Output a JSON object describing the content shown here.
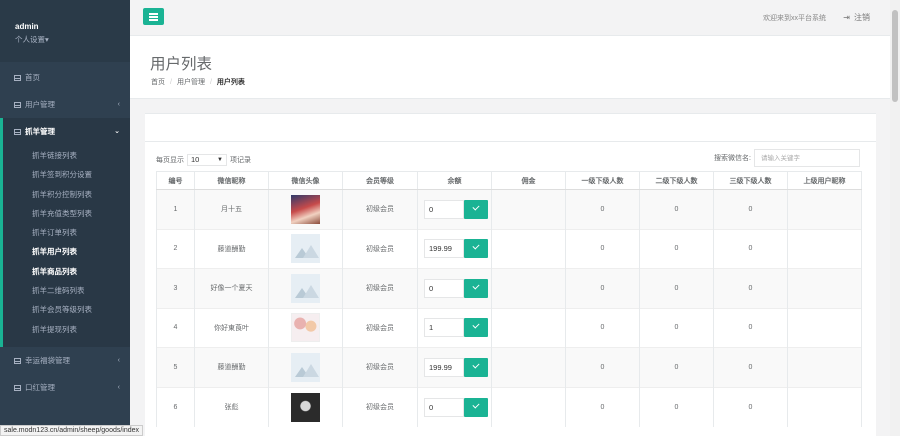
{
  "sidebar": {
    "username": "admin",
    "settings_label": "个人设置▾",
    "items": [
      {
        "label": "首页",
        "chevron": ""
      },
      {
        "label": "用户管理",
        "chevron": "‹"
      }
    ],
    "active_group": {
      "label": "抓羊管理",
      "chevron": "⌄"
    },
    "sub_items": [
      "抓羊链接列表",
      "抓羊签到积分设置",
      "抓羊积分控制列表",
      "抓羊充值类型列表",
      "抓羊订单列表",
      "抓羊用户列表",
      "抓羊商品列表",
      "抓羊二维码列表",
      "抓羊会员等级列表",
      "抓羊提现列表"
    ],
    "bottom_items": [
      {
        "label": "幸运福袋管理",
        "chevron": "‹"
      },
      {
        "label": "口红管理",
        "chevron": "‹"
      }
    ]
  },
  "topbar": {
    "welcome": "欢迎来到xx平台系统",
    "logout": "注销",
    "logout_icon": "sign-out-icon"
  },
  "page": {
    "title": "用户列表",
    "breadcrumb": [
      "首页",
      "用户管理",
      "用户列表"
    ]
  },
  "table_controls": {
    "per_page_prefix": "每页显示",
    "per_page_value": "10",
    "per_page_suffix": "项记录",
    "search_label": "搜索微信名:",
    "search_placeholder": "请输入关键字"
  },
  "table": {
    "headers": [
      "编号",
      "微信昵称",
      "微信头像",
      "会员等级",
      "余额",
      "佣金",
      "一级下级人数",
      "二级下级人数",
      "三级下级人数",
      "上级用户昵称"
    ],
    "rows": [
      {
        "id": "1",
        "nick": "月十五",
        "avatar": "p1",
        "level": "初级会员",
        "balance": "0",
        "commission": "",
        "l1": "0",
        "l2": "0",
        "l3": "0",
        "parent": ""
      },
      {
        "id": "2",
        "nick": "藤道酬勤",
        "avatar": "ph",
        "level": "初级会员",
        "balance": "199.99",
        "commission": "",
        "l1": "0",
        "l2": "0",
        "l3": "0",
        "parent": ""
      },
      {
        "id": "3",
        "nick": "好像一个夏天",
        "avatar": "ph",
        "level": "初级会员",
        "balance": "0",
        "commission": "",
        "l1": "0",
        "l2": "0",
        "l3": "0",
        "parent": ""
      },
      {
        "id": "4",
        "nick": "你好東莨叶",
        "avatar": "p4",
        "level": "初级会员",
        "balance": "1",
        "commission": "",
        "l1": "0",
        "l2": "0",
        "l3": "0",
        "parent": ""
      },
      {
        "id": "5",
        "nick": "藤道酬勤",
        "avatar": "ph",
        "level": "初级会员",
        "balance": "199.99",
        "commission": "",
        "l1": "0",
        "l2": "0",
        "l3": "0",
        "parent": ""
      },
      {
        "id": "6",
        "nick": "张彪",
        "avatar": "p6",
        "level": "初级会员",
        "balance": "0",
        "commission": "",
        "l1": "0",
        "l2": "0",
        "l3": "0",
        "parent": ""
      }
    ]
  },
  "status_url": "sale.modn123.cn/admin/sheep/goods/index",
  "colors": {
    "accent": "#1ab394",
    "sidebar": "#2f4050"
  }
}
